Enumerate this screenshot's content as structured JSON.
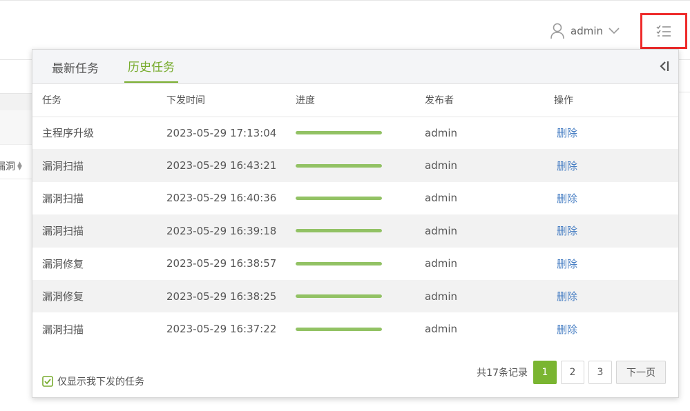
{
  "header": {
    "username": "admin"
  },
  "background": {
    "column_label": "漏洞"
  },
  "tasks_panel": {
    "tabs": [
      {
        "label": "最新任务",
        "active": false
      },
      {
        "label": "历史任务",
        "active": true
      }
    ],
    "columns": [
      "任务",
      "下发时间",
      "进度",
      "发布者",
      "操作"
    ],
    "rows": [
      {
        "task": "主程序升级",
        "time": "2023-05-29 17:13:04",
        "progress": 1.0,
        "publisher": "admin",
        "action": "删除"
      },
      {
        "task": "漏洞扫描",
        "time": "2023-05-29 16:43:21",
        "progress": 1.0,
        "publisher": "admin",
        "action": "删除"
      },
      {
        "task": "漏洞扫描",
        "time": "2023-05-29 16:40:36",
        "progress": 1.0,
        "publisher": "admin",
        "action": "删除"
      },
      {
        "task": "漏洞扫描",
        "time": "2023-05-29 16:39:18",
        "progress": 1.0,
        "publisher": "admin",
        "action": "删除"
      },
      {
        "task": "漏洞修复",
        "time": "2023-05-29 16:38:57",
        "progress": 1.0,
        "publisher": "admin",
        "action": "删除"
      },
      {
        "task": "漏洞修复",
        "time": "2023-05-29 16:38:25",
        "progress": 1.0,
        "publisher": "admin",
        "action": "删除"
      },
      {
        "task": "漏洞扫描",
        "time": "2023-05-29 16:37:22",
        "progress": 1.0,
        "publisher": "admin",
        "action": "删除"
      }
    ],
    "only_mine_label": "仅显示我下发的任务",
    "only_mine_checked": true,
    "pagination": {
      "total_text": "共17条记录",
      "pages": [
        "1",
        "2",
        "3"
      ],
      "current": "1",
      "next_label": "下一页"
    }
  },
  "colors": {
    "accent": "#78ac2e",
    "progress": "#92c264",
    "link": "#4a80c4",
    "highlight_box": "#ee2b2b"
  }
}
